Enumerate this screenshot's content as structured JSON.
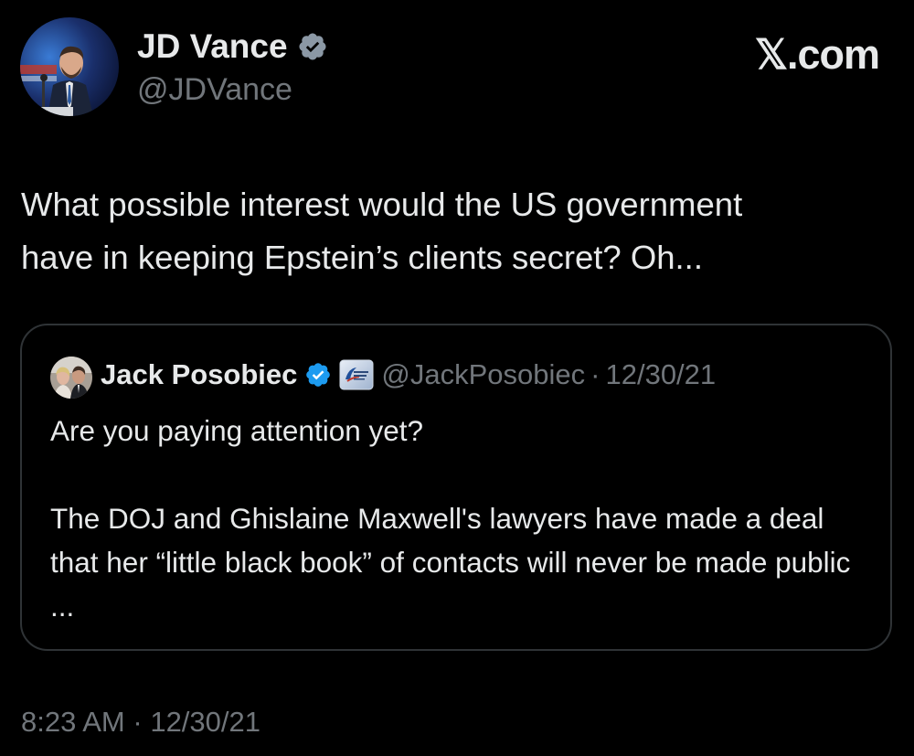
{
  "author": {
    "name": "JD Vance",
    "handle": "@JDVance",
    "verified_badge_icon": "verified-badge-icon",
    "badge_color": "#1d9bf0"
  },
  "brand": "𝕏.com",
  "tweet": {
    "text_line1": "What possible interest would the US government",
    "text_line2": "have in keeping Epstein’s clients secret? Oh..."
  },
  "quote": {
    "name": "Jack Posobiec",
    "handle": "@JackPosobiec",
    "separator": "·",
    "date": "12/30/21",
    "paragraph1": "Are you paying attention yet?",
    "paragraph2": "The DOJ and Ghislaine Maxwell's lawyers have made a deal that her “little black book” of contacts will never be made public ...",
    "icons": [
      "verified-badge-icon",
      "affiliation-badge-icon"
    ]
  },
  "meta": {
    "time": "8:23 AM",
    "separator": "·",
    "date": "12/30/21"
  },
  "colors": {
    "background": "#000000",
    "text_primary": "#e7e9ea",
    "text_secondary": "#71767b",
    "border": "#2f3336",
    "accent": "#1d9bf0"
  }
}
